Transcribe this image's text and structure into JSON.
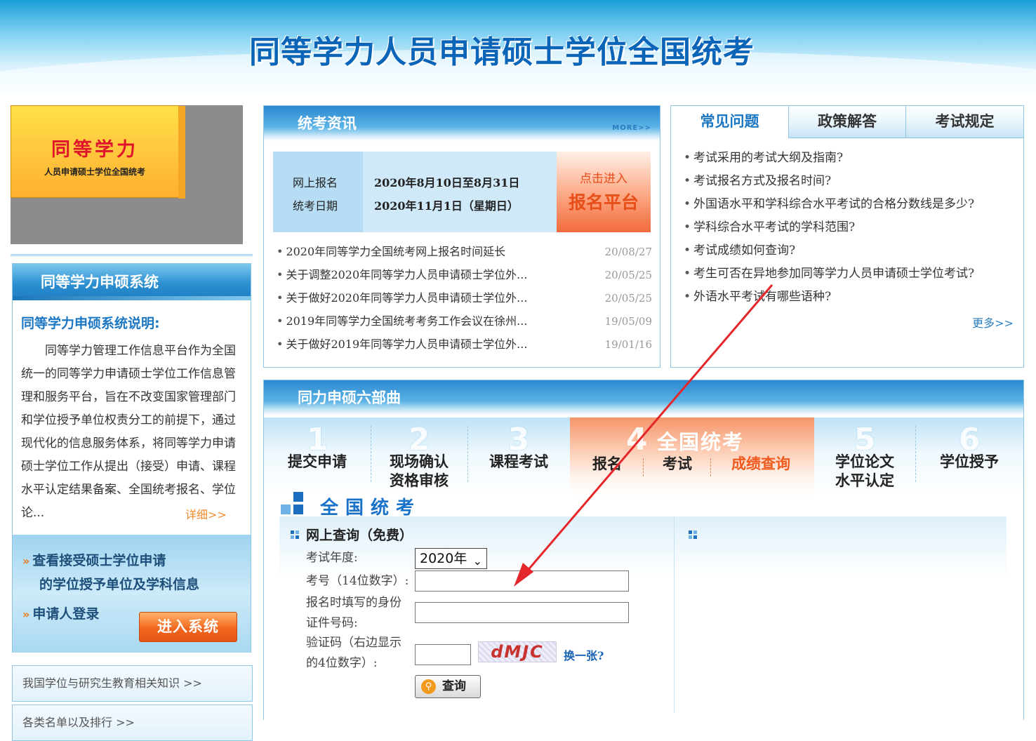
{
  "banner": {
    "title": "同等学力人员申请硕士学位全国统考"
  },
  "logo": {
    "title": "同等学力",
    "subtitle": "人员申请硕士学位全国统考"
  },
  "system": {
    "header": "同等学力申硕系统",
    "desc_title": "同等学力申硕系统说明:",
    "desc": "同等学力管理工作信息平台作为全国统一的同等学力申请硕士学位工作信息管理和服务平台，旨在不改变国家管理部门和学位授予单位权责分工的前提下，通过现代化的信息服务体系，将同等学力申请硕士学位工作从提出（接受）申请、课程水平认定结果备案、全国统考报名、学位论...",
    "detail": "详细>>",
    "link1_line1": "查看接受硕士学位申请",
    "link1_line2": "的学位授予单位及学科信息",
    "link2": "申请人登录",
    "enter_button": "进入系统"
  },
  "side_links": [
    "我国学位与研究生教育相关知识 >>",
    "各类名单以及排行 >>"
  ],
  "news": {
    "header": "统考资讯",
    "more": "MORE>>",
    "reg_label1": "网上报名",
    "reg_label2": "统考日期",
    "reg_date1": "2020年8月10日至8月31日",
    "reg_date2": "2020年11月1日（星期日）",
    "enter_small": "点击进入",
    "enter_big": "报名平台",
    "items": [
      {
        "title": "2020年同等学力全国统考网上报名时间延长",
        "date": "20/08/27"
      },
      {
        "title": "关于调整2020年同等学力人员申请硕士学位外...",
        "date": "20/05/25"
      },
      {
        "title": "关于做好2020年同等学力人员申请硕士学位外...",
        "date": "20/05/25"
      },
      {
        "title": "2019年同等学力全国统考考务工作会议在徐州...",
        "date": "19/05/09"
      },
      {
        "title": "关于做好2019年同等学力人员申请硕士学位外...",
        "date": "19/01/16"
      }
    ]
  },
  "faq": {
    "tabs": [
      "常见问题",
      "政策解答",
      "考试规定"
    ],
    "items": [
      "考试采用的考试大纲及指南?",
      "考试报名方式及报名时间?",
      "外国语水平和学科综合水平考试的合格分数线是多少?",
      "学科综合水平考试的学科范围?",
      "考试成绩如何查询?",
      "考生可否在异地参加同等学力人员申请硕士学位考试?",
      "外语水平考试有哪些语种?"
    ],
    "more": "更多>>"
  },
  "steps": {
    "header": "同力申硕六部曲",
    "items": [
      {
        "num": "1",
        "label": "提交申请"
      },
      {
        "num": "2",
        "label": "现场确认\n资格审核"
      },
      {
        "num": "3",
        "label": "课程考试"
      },
      {
        "num": "4",
        "label": "全国统考"
      },
      {
        "num": "5",
        "label": "学位论文\n水平认定"
      },
      {
        "num": "6",
        "label": "学位授予"
      }
    ],
    "sub": [
      "报名",
      "考试",
      "成绩查询"
    ],
    "colors": {
      "active": "#f05a1e",
      "accent": "#1c77c3"
    }
  },
  "query": {
    "section_title": "全国统考",
    "title": "网上查询（免费）",
    "year_label": "考试年度:",
    "year_value": "2020年",
    "exam_no_label": "考号（14位数字）:",
    "id_label_1": "报名时填写的身份",
    "id_label_2": "证件号码:",
    "captcha_label_1": "验证码（右边显示",
    "captcha_label_2": "的4位数字）:",
    "captcha_text": "dMJC",
    "refresh": "换一张?",
    "button": "查询"
  }
}
